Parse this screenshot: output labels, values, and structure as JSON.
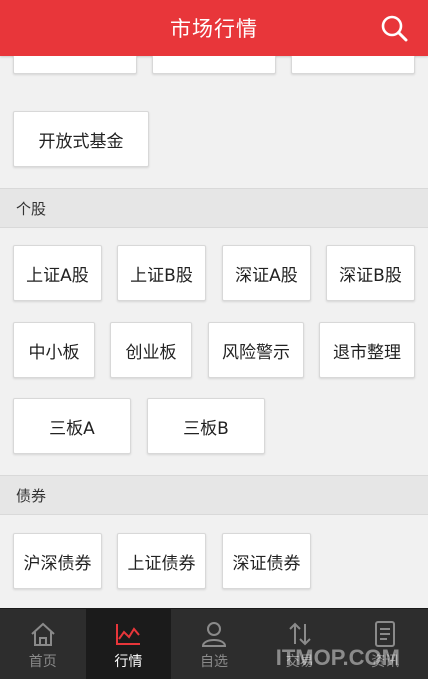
{
  "header": {
    "title": "市场行情",
    "search_icon": "search-icon"
  },
  "top_row": {
    "items": [
      "",
      "",
      ""
    ]
  },
  "funds": {
    "items": [
      "开放式基金"
    ]
  },
  "stocks": {
    "title": "个股",
    "row1": [
      "上证A股",
      "上证B股",
      "深证A股",
      "深证B股"
    ],
    "row2": [
      "中小板",
      "创业板",
      "风险警示",
      "退市整理"
    ],
    "row3": [
      "三板A",
      "三板B"
    ]
  },
  "bonds": {
    "title": "债券",
    "row1": [
      "沪深债券",
      "上证债券",
      "深证债券"
    ]
  },
  "tabbar": {
    "items": [
      {
        "label": "首页",
        "icon": "home-icon"
      },
      {
        "label": "行情",
        "icon": "market-chart-icon"
      },
      {
        "label": "自选",
        "icon": "user-icon"
      },
      {
        "label": "交易",
        "icon": "trade-arrows-icon"
      },
      {
        "label": "资讯",
        "icon": "news-icon"
      }
    ],
    "active_index": 1
  },
  "watermark": "ITMOP.COM",
  "colors": {
    "brand_red": "#e8363a",
    "tabbar_bg": "#2d2d2d",
    "active_tab_bg": "#1b1b1b"
  }
}
